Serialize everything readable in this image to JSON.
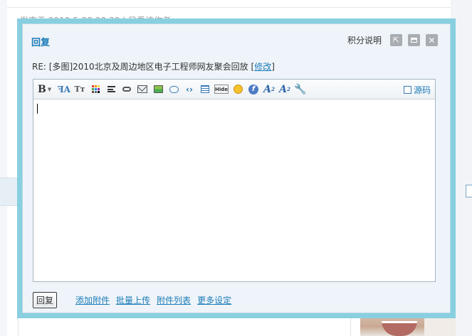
{
  "background": {
    "post_meta": "发表于 2010-5-28 20:38 | 只看该作者"
  },
  "dialog": {
    "title": "回复",
    "points_label": "积分说明",
    "subject_prefix": "RE: [多图]2010北京及周边地区电子工程师网友聚会回放",
    "edit_label": "修改",
    "bracket_open": "[",
    "bracket_close": "]"
  },
  "toolbar": {
    "bold": "B",
    "size": "Tт",
    "hide": "Hide",
    "code": "‹›",
    "sup": "A",
    "sub": "A",
    "source_label": "源码"
  },
  "footer": {
    "reply_button": "回复",
    "links": [
      "添加附件",
      "批量上传",
      "附件列表",
      "更多设定"
    ]
  },
  "colors": {
    "frame": "#88cfe0",
    "accent": "#1c7bb8",
    "dialog_bg": "#eef4f9"
  }
}
